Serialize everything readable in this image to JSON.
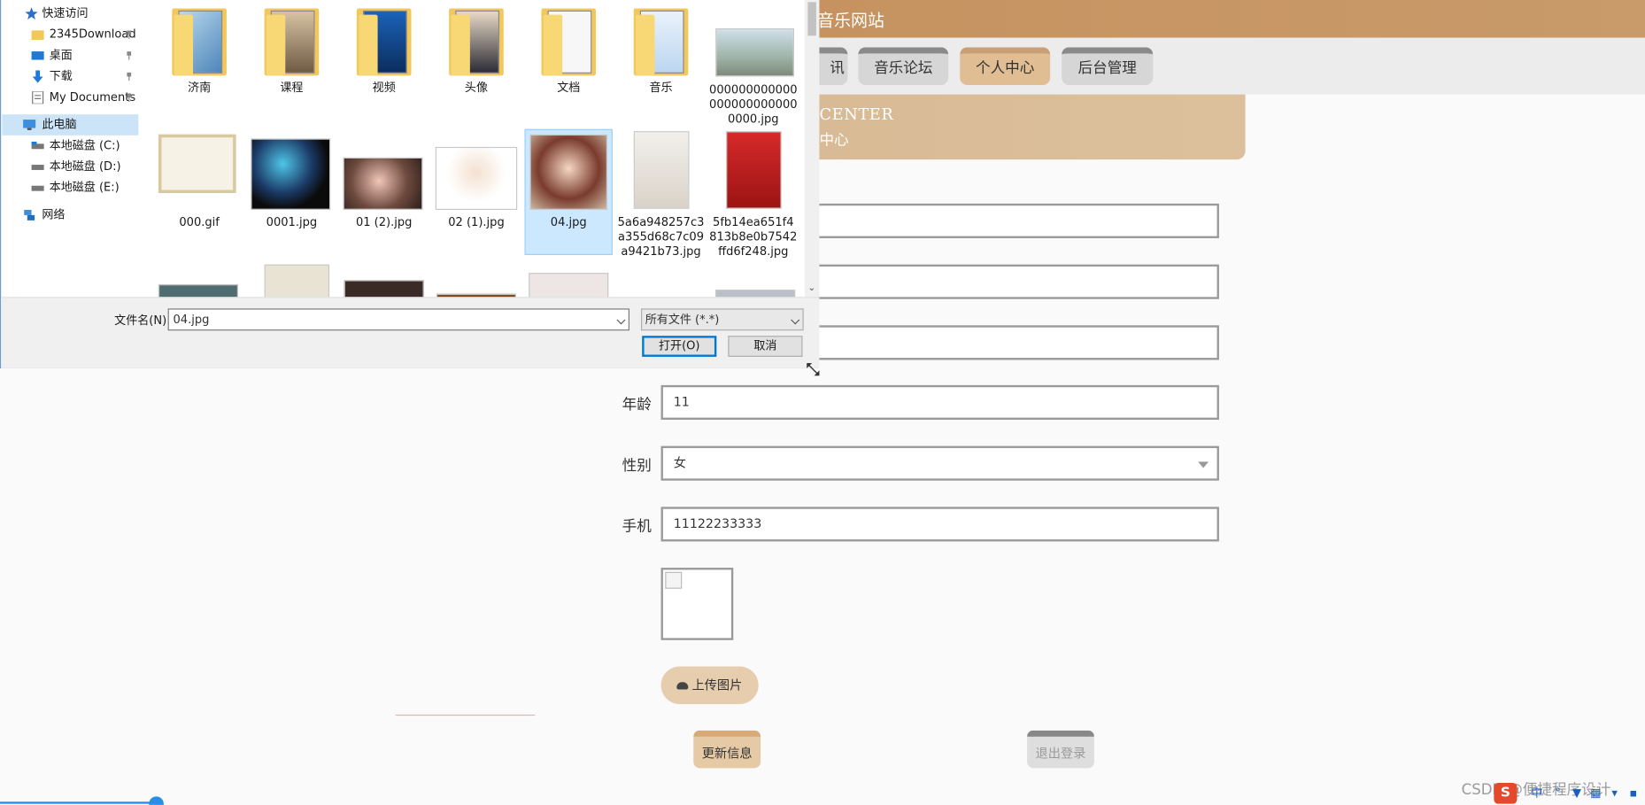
{
  "site": {
    "title": "音乐网站",
    "nav": [
      "讯",
      "音乐论坛",
      "个人中心",
      "后台管理"
    ],
    "banner_en": "CENTER",
    "banner_cn": "中心"
  },
  "form": {
    "age_label": "年龄",
    "age_value": "11",
    "gender_label": "性别",
    "gender_value": "女",
    "phone_label": "手机",
    "phone_value": "11122233333",
    "upload_label": "上传图片",
    "update_label": "更新信息",
    "logout_label": "退出登录"
  },
  "watermark": "CSDN @便捷程序设计",
  "tray": {
    "ime_label": "S",
    "ime_mode": "中"
  },
  "dialog": {
    "nav": {
      "quick_access": "快速访问",
      "pinned": [
        "2345Download",
        "桌面",
        "下载",
        "My Documents"
      ],
      "this_pc": "此电脑",
      "drives": [
        "本地磁盘 (C:)",
        "本地磁盘 (D:)",
        "本地磁盘 (E:)"
      ],
      "network": "网络"
    },
    "row1": [
      "济南",
      "课程",
      "视频",
      "头像",
      "文档",
      "音乐",
      "0000000000000000000000000000.jpg"
    ],
    "row2": [
      "000.gif",
      "0001.jpg",
      "01 (2).jpg",
      "02 (1).jpg",
      "04.jpg",
      "5a6a948257c3a355d68c7c09a9421b73.jpg",
      "5fb14ea651f4813b8e0b7542ffd6f248.jpg"
    ],
    "selected_file": "04.jpg",
    "filename_label": "文件名(N):",
    "filename_value": "04.jpg",
    "filetype_value": "所有文件 (*.*)",
    "open_label": "打开(O)",
    "cancel_label": "取消"
  }
}
